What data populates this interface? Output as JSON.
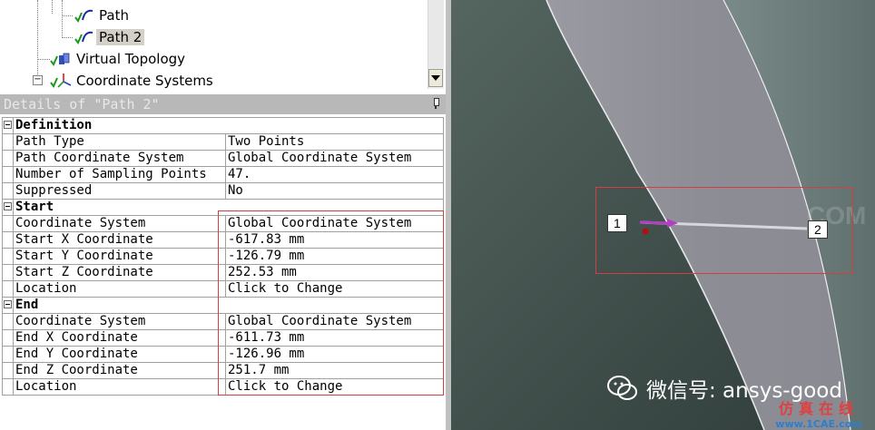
{
  "tree": {
    "items": [
      {
        "label": "Path",
        "icon": "path-icon"
      },
      {
        "label": "Path 2",
        "icon": "path-icon",
        "selected": true
      },
      {
        "label": "Virtual Topology",
        "icon": "virtual-topology-icon"
      },
      {
        "label": "Coordinate Systems",
        "icon": "coordinate-systems-icon"
      }
    ]
  },
  "details": {
    "title": "Details of \"Path 2\"",
    "groups": [
      {
        "name": "Definition",
        "rows": [
          {
            "label": "Path Type",
            "value": "Two Points"
          },
          {
            "label": "Path Coordinate System",
            "value": "Global Coordinate System"
          },
          {
            "label": "Number of Sampling Points",
            "value": "47."
          },
          {
            "label": "Suppressed",
            "value": "No"
          }
        ]
      },
      {
        "name": "Start",
        "rows": [
          {
            "label": "Coordinate System",
            "value": "Global Coordinate System"
          },
          {
            "label": "Start X Coordinate",
            "value": "-617.83 mm"
          },
          {
            "label": "Start Y Coordinate",
            "value": "-126.79 mm"
          },
          {
            "label": "Start Z Coordinate",
            "value": "252.53 mm"
          },
          {
            "label": "Location",
            "value": "Click to Change"
          }
        ]
      },
      {
        "name": "End",
        "rows": [
          {
            "label": "Coordinate System",
            "value": "Global Coordinate System"
          },
          {
            "label": "End X Coordinate",
            "value": "-611.73 mm"
          },
          {
            "label": "End Y Coordinate",
            "value": "-126.96 mm"
          },
          {
            "label": "End Z Coordinate",
            "value": "251.7 mm"
          },
          {
            "label": "Location",
            "value": "Click to Change"
          }
        ]
      }
    ]
  },
  "viewport": {
    "point1": "1",
    "point2": "2",
    "watermark": "COM"
  },
  "overlay": {
    "wechat": "微信号: ansys-good",
    "brand_cn": "仿真在线",
    "brand_url": "www.1CAE.com"
  },
  "colors": {
    "highlight": "#d04040",
    "surface": "#8f8f98",
    "background_dark": "#3d4a48",
    "path_arrow": "#b040c0"
  }
}
